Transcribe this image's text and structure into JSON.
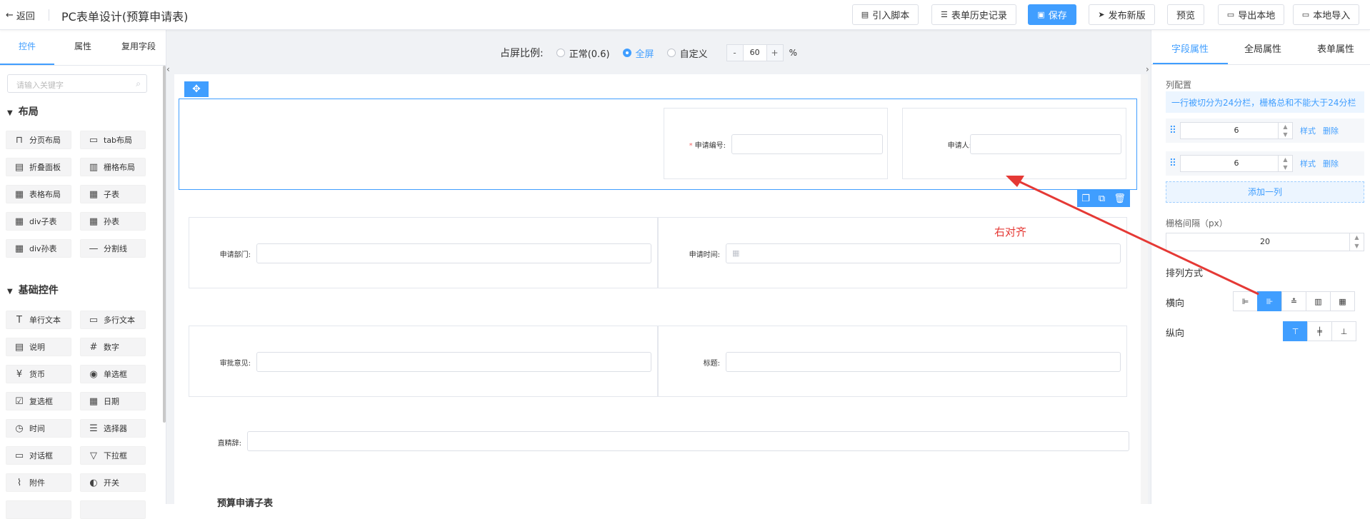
{
  "header": {
    "back_label": "返回",
    "title": "PC表单设计(预算申请表)",
    "buttons": [
      {
        "label": "引入脚本",
        "icon": "script-icon"
      },
      {
        "label": "表单历史记录",
        "icon": "history-icon"
      },
      {
        "label": "保存",
        "icon": "save-icon"
      },
      {
        "label": "发布新版",
        "icon": "send-icon"
      },
      {
        "label": "预览",
        "icon": ""
      },
      {
        "label": "导出本地",
        "icon": "folder-icon"
      },
      {
        "label": "本地导入",
        "icon": "folder-icon"
      }
    ]
  },
  "left_panel": {
    "tabs": [
      "控件",
      "属性",
      "复用字段"
    ],
    "search_placeholder": "请输入关键字",
    "sections": [
      {
        "title": "布局",
        "items": [
          "分页布局",
          "tab布局",
          "折叠面板",
          "栅格布局",
          "表格布局",
          "子表",
          "div子表",
          "孙表",
          "div孙表",
          "分割线"
        ]
      },
      {
        "title": "基础控件",
        "items": [
          "单行文本",
          "多行文本",
          "说明",
          "数字",
          "货币",
          "单选框",
          "复选框",
          "日期",
          "时间",
          "选择器",
          "对话框",
          "下拉框",
          "附件",
          "开关"
        ]
      }
    ]
  },
  "toolbar": {
    "ratio_label": "占屏比例:",
    "options": [
      "正常(0.6)",
      "全屏",
      "自定义"
    ],
    "selected": "全屏",
    "custom_value": "60",
    "unit": "%",
    "minus": "-",
    "plus": "+"
  },
  "form": {
    "fields": [
      {
        "label": "申请编号:",
        "required": true
      },
      {
        "label": "申请人:",
        "required": false
      },
      {
        "label": "申请部门:",
        "required": false
      },
      {
        "label": "申请时间:",
        "required": false
      },
      {
        "label": "审批意见:",
        "required": false
      },
      {
        "label": "标题:",
        "required": false
      },
      {
        "label": "直精辞:",
        "required": false
      }
    ],
    "subtable_title": "预算申请子表",
    "annotation": "右对齐"
  },
  "right_panel": {
    "tabs": [
      "字段属性",
      "全局属性",
      "表单属性"
    ],
    "col_config_label": "列配置",
    "tip": "一行被切分为24分栏，栅格总和不能大于24分栏",
    "columns": [
      {
        "value": "6",
        "style_link": "样式",
        "delete_link": "删除"
      },
      {
        "value": "6",
        "style_link": "样式",
        "delete_link": "删除"
      }
    ],
    "add_column": "添加一列",
    "gutter_label": "栅格间隔（px）",
    "gutter_value": "20",
    "arrange_label": "排列方式",
    "horizontal_label": "横向",
    "vertical_label": "纵向",
    "horizontal_selected": 1,
    "vertical_selected": 0
  }
}
